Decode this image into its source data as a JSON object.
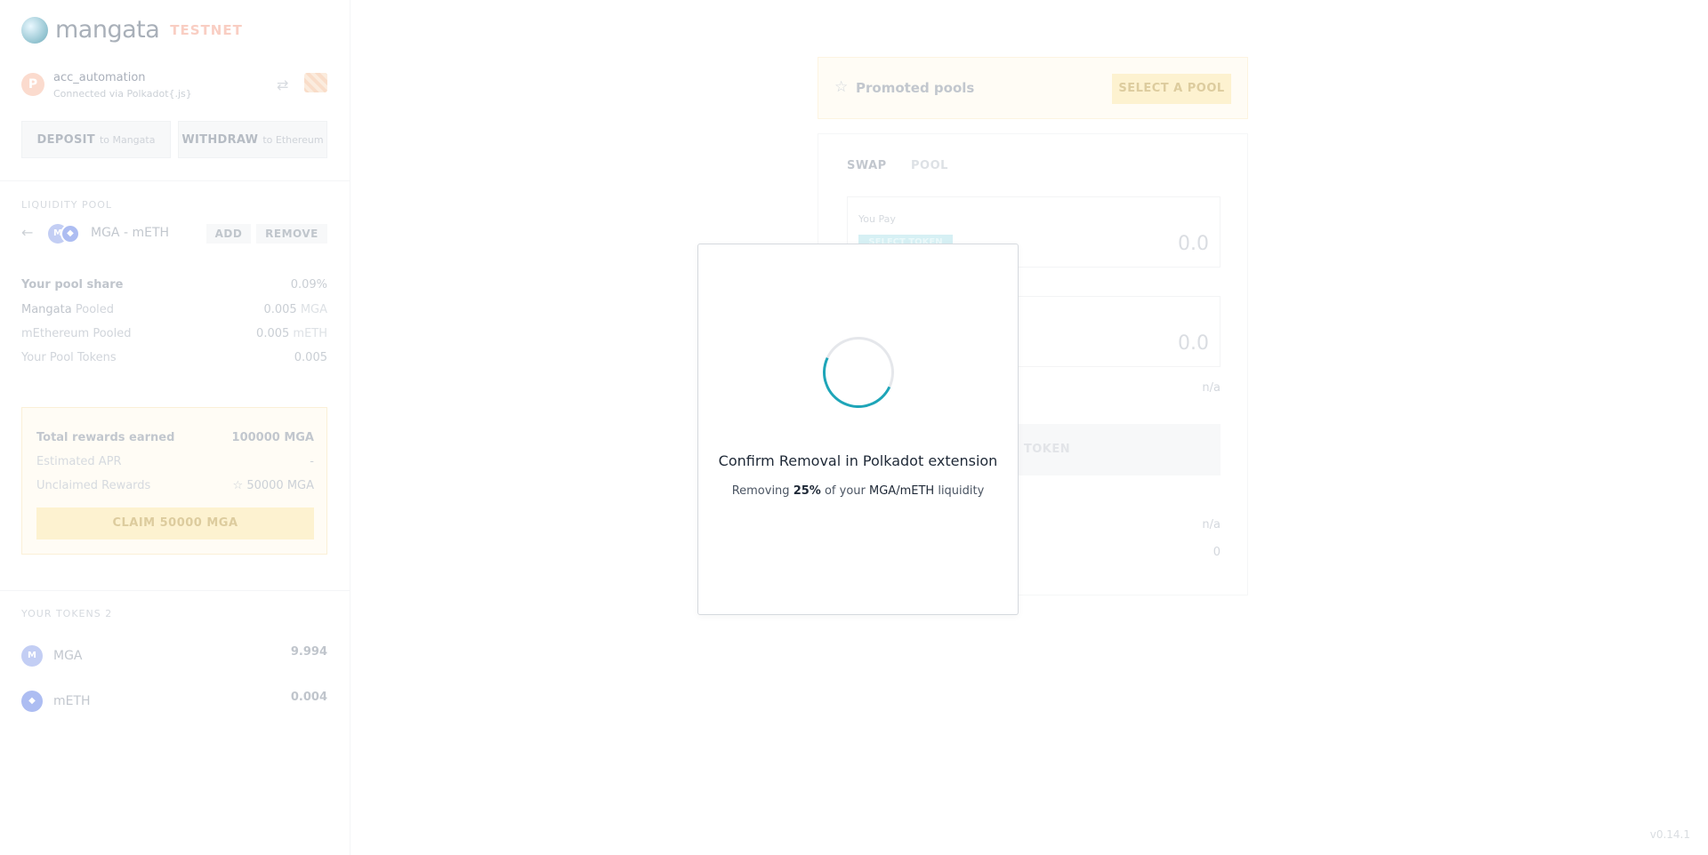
{
  "brand": {
    "name": "mangata",
    "badge": "TESTNET"
  },
  "account": {
    "avatar_letter": "P",
    "name": "acc_automation",
    "subtitle": "Connected via Polkadot{.js}"
  },
  "actions": {
    "deposit_label": "DEPOSIT",
    "deposit_suffix": "to Mangata",
    "withdraw_label": "WITHDRAW",
    "withdraw_suffix": "to Ethereum"
  },
  "liquidity_pool": {
    "section_label": "LIQUIDITY POOL",
    "pair_name": "MGA - mETH",
    "add_label": "ADD",
    "remove_label": "REMOVE",
    "stats": [
      {
        "label": "Your pool share",
        "value": "0.09%",
        "unit": ""
      },
      {
        "label_strong": "Mangata",
        "label": "Pooled",
        "value": "0.005",
        "unit": "MGA"
      },
      {
        "label_strong": "mEthereum",
        "label": "Pooled",
        "value": "0.005",
        "unit": "mETH"
      },
      {
        "label": "Your Pool Tokens",
        "value": "0.005",
        "unit": ""
      }
    ]
  },
  "rewards": {
    "total_label": "Total rewards earned",
    "total_value": "100000 MGA",
    "apr_label": "Estimated APR",
    "apr_value": "-",
    "unclaimed_label": "Unclaimed Rewards",
    "unclaimed_value": "50000 MGA",
    "claim_label": "CLAIM 50000 MGA"
  },
  "tokens": {
    "section_label": "YOUR TOKENS 2",
    "items": [
      {
        "name": "MGA",
        "icon_text": "M",
        "value": "9.994",
        "color": "#b9c6f3"
      },
      {
        "name": "mETH",
        "icon_text": "◆",
        "value": "0.004",
        "color": "#9fb2f0"
      }
    ]
  },
  "promoted": {
    "title": "Promoted pools",
    "button": "SELECT A POOL"
  },
  "swap": {
    "tab_swap": "SWAP",
    "tab_pool": "POOL",
    "you_pay_label": "You Pay",
    "select_token_label": "SELECT TOKEN",
    "pay_value": "0.0",
    "receive_value": "0.0",
    "rate_value": "n/a",
    "action_label": "T A TOKEN",
    "fee_value": "n/a",
    "min_value": "0"
  },
  "modal": {
    "title": "Confirm Removal in Polkadot extension",
    "sub_prefix": "Removing",
    "sub_percent": "25%",
    "sub_mid": "of your",
    "sub_pair": "MGA/mETH",
    "sub_suffix": "liquidity"
  },
  "version": "v0.14.1",
  "colors": {
    "accent": "#1ea5b8",
    "promo": "#fdf0c8"
  }
}
